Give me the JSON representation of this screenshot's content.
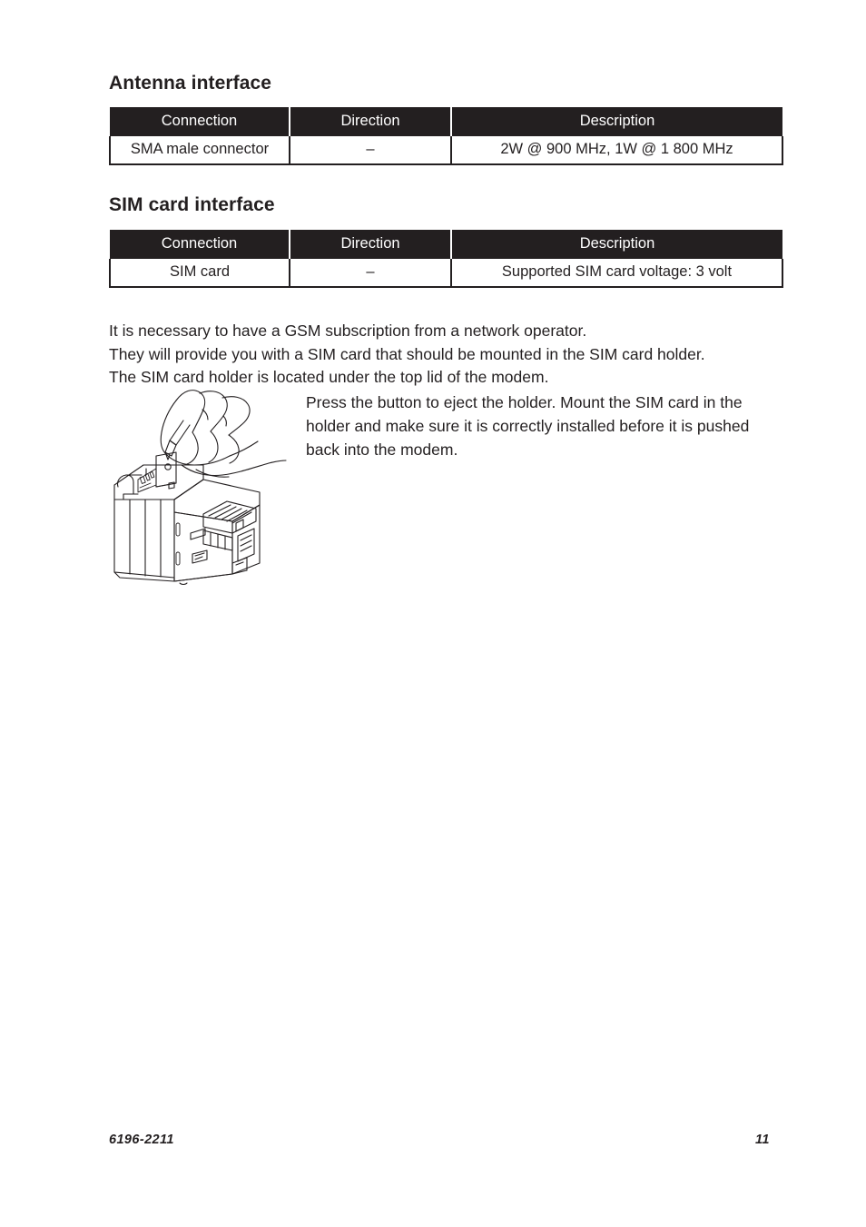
{
  "document": {
    "sections": [
      {
        "heading": "Antenna interface",
        "table": {
          "columns": [
            "Connection",
            "Direction",
            "Description"
          ],
          "rows": [
            [
              "SMA male connector",
              "–",
              "2W @ 900 MHz, 1W @ 1 800 MHz"
            ]
          ]
        }
      },
      {
        "heading": "SIM card interface",
        "table": {
          "columns": [
            "Connection",
            "Direction",
            "Description"
          ],
          "rows": [
            [
              "SIM card",
              "–",
              "Supported SIM card voltage: 3 volt"
            ]
          ]
        }
      }
    ],
    "intro_paragraph": {
      "lines": [
        "It is necessary to have a GSM subscription from a network operator.",
        "They will provide you with a SIM card that should be mounted in the SIM card holder.",
        "The SIM card holder is located under the top lid of the modem."
      ]
    },
    "instruction_paragraph": "Press the button to eject the holder. Mount the SIM card in the holder and make sure it is correctly installed before it is pushed back into the modem.",
    "illustration": {
      "name": "hand-pressing-sim-eject-button-on-modem",
      "description": "Line drawing of a hand holding a pen pressing the SIM holder eject button on a DIN-rail GSM modem"
    },
    "footer": {
      "document_number": "6196-2211",
      "page_number": "11"
    },
    "colors": {
      "ink": "#231f20",
      "paper": "#ffffff",
      "table_header_background": "#231f20",
      "table_header_text": "#ffffff"
    }
  }
}
